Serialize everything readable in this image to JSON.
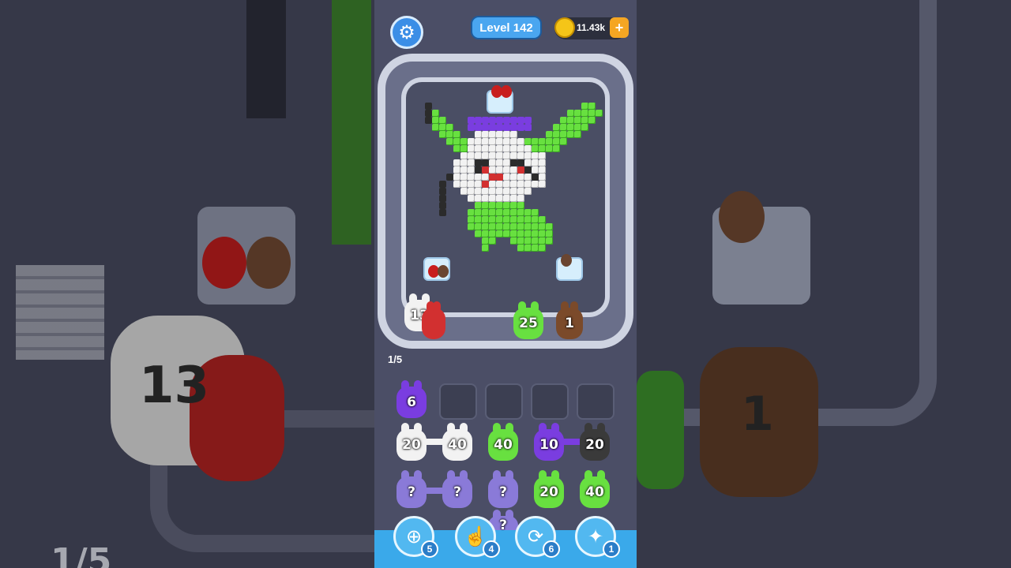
{
  "header": {
    "level_label": "Level 142",
    "coins": "11.43k",
    "coin_plus": "+"
  },
  "board": {
    "queue_bunnies": [
      {
        "count": "13",
        "color": "white"
      },
      {
        "count": "25",
        "color": "green"
      },
      {
        "count": "1",
        "color": "brown"
      }
    ]
  },
  "progress": "1/5",
  "slots": {
    "filled": [
      {
        "count": "6",
        "color": "purple"
      }
    ],
    "empty_slots": 4
  },
  "grid": {
    "row1": [
      {
        "count": "20",
        "color": "white"
      },
      {
        "count": "40",
        "color": "white"
      },
      {
        "count": "40",
        "color": "green"
      },
      {
        "count": "10",
        "color": "purple"
      },
      {
        "count": "20",
        "color": "black"
      }
    ],
    "row2": [
      {
        "count": "?",
        "color": "purple-hidden"
      },
      {
        "count": "?",
        "color": "purple-hidden"
      },
      {
        "count": "?",
        "color": "purple-hidden"
      },
      {
        "count": "20",
        "color": "green"
      },
      {
        "count": "40",
        "color": "green"
      }
    ],
    "row3": [
      {
        "count": "?",
        "color": "purple-hidden"
      }
    ]
  },
  "tools": [
    {
      "name": "add-slot-icon",
      "count": "5"
    },
    {
      "name": "hand-icon",
      "count": "4"
    },
    {
      "name": "shuffle-icon",
      "count": "6"
    },
    {
      "name": "bunny-power-icon",
      "count": "1"
    }
  ],
  "colors": {
    "green": "#68e040",
    "white": "#f2f2f2",
    "purple": "#7a3de0",
    "purple_hidden": "#8a7ad8",
    "black": "#3a3a3a",
    "brown": "#7b4a2a",
    "red": "#d23030",
    "accent_blue": "#3aa9ea"
  }
}
